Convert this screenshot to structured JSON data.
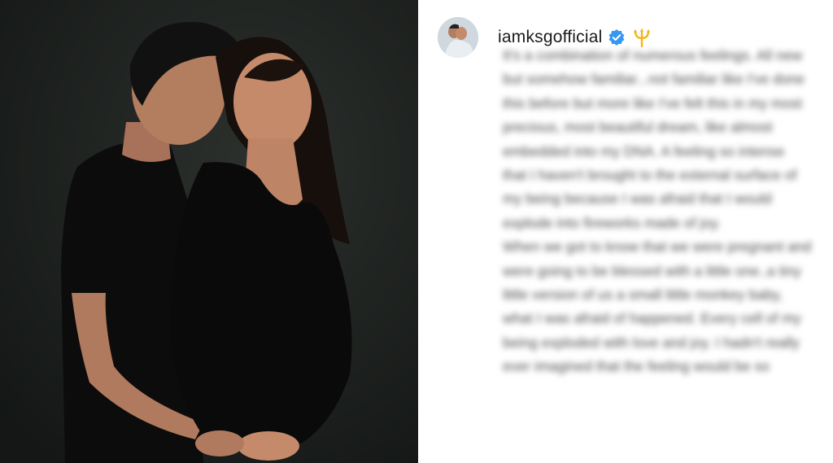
{
  "post": {
    "username": "iamksgofficial",
    "verified_icon": "verified-badge-icon",
    "emoji_icon": "trident-icon",
    "accent_color": "#3897f0",
    "emoji_color": "#f2b51b"
  },
  "caption": {
    "paragraphs": [
      "It's a combination of numerous feelings. All new but somehow familiar...not familiar like I've done this before but more like I've felt this in my most precious, most beautiful dream, like almost embedded into my DNA. A feeling so intense that I haven't brought to the external surface of my being because I was afraid that I would explode into fireworks made of joy.",
      "When we got to know that we were pregnant and were going to be blessed with a little one..a tiny little version of us a small little monkey baby, what I was afraid of happened. Every cell of my being exploded with love and joy. I hadn't really ever imagined that the feeling would be so"
    ]
  }
}
